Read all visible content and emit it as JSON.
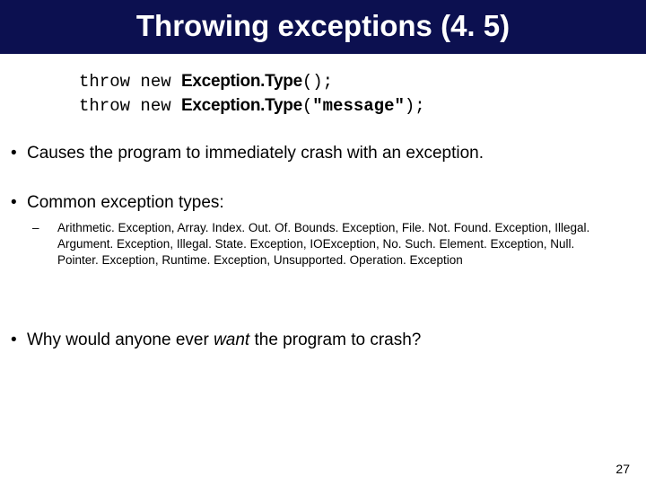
{
  "title": "Throwing exceptions (4. 5)",
  "code": {
    "line1_kw": "throw new ",
    "line1_et": "Exception.Type",
    "line1_tail": "();",
    "line2_kw": "throw new ",
    "line2_et": "Exception.Type",
    "line2_paren_open": "(",
    "line2_msg": "\"message\"",
    "line2_tail": ");"
  },
  "bullets": {
    "b1": "Causes the program to immediately crash with an exception.",
    "b2": "Common exception types:",
    "sub": "Arithmetic. Exception, Array. Index. Out. Of. Bounds. Exception, File. Not. Found. Exception, Illegal. Argument. Exception, Illegal. State. Exception, IOException, No. Such. Element. Exception, Null. Pointer. Exception, Runtime. Exception, Unsupported. Operation. Exception",
    "b3_pre": "Why would anyone ever ",
    "b3_em": "want",
    "b3_post": "  the program to crash?"
  },
  "page_number": "27"
}
